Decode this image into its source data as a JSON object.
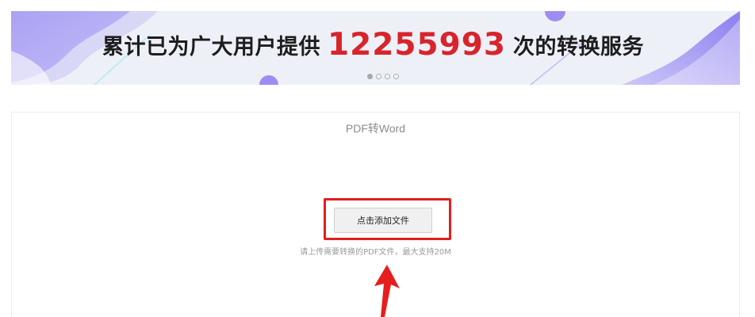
{
  "banner": {
    "prefix": "累计已为广大用户提供",
    "count": "12255993",
    "suffix": "次的转换服务",
    "slides_total": 4,
    "active_slide": 1,
    "colors": {
      "background": "#eef0f7",
      "accent": "#8a7cf0",
      "count": "#d8242b"
    }
  },
  "panel": {
    "title": "PDF转Word",
    "add_button_label": "点击添加文件",
    "hint": "请上传需要转换的PDF文件，最大支持20M",
    "highlight_color": "#e21e1e"
  }
}
